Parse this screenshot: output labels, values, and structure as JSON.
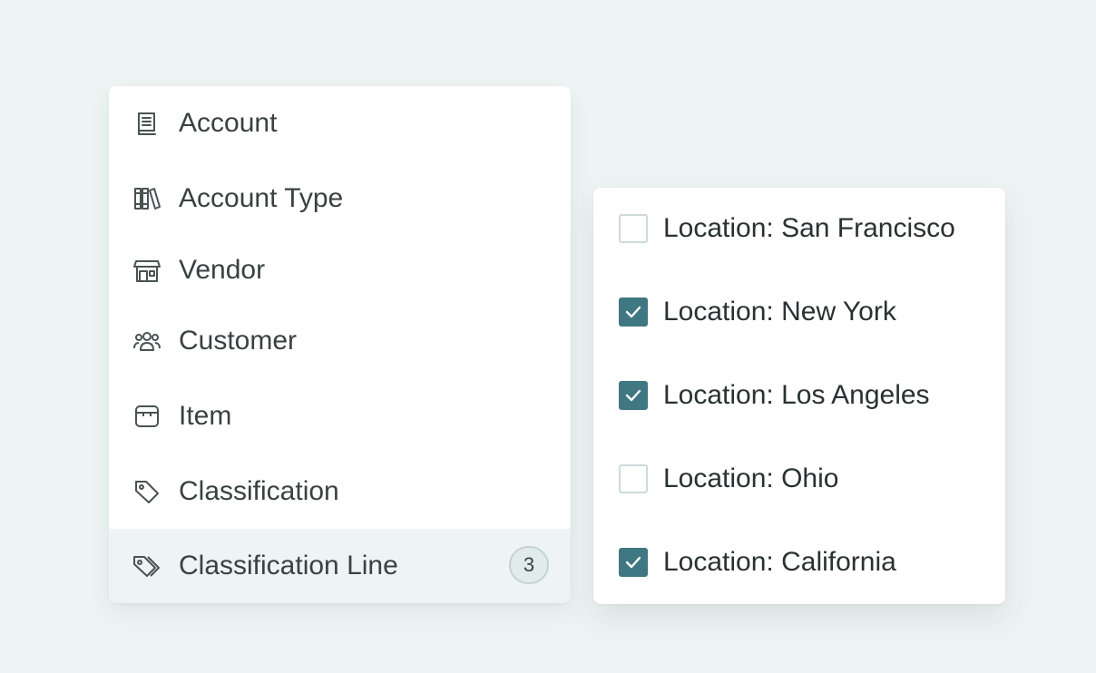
{
  "menu": {
    "items": [
      {
        "label": "Account",
        "icon": "ledger-book-icon"
      },
      {
        "label": "Account Type",
        "icon": "books-icon"
      },
      {
        "label": "Vendor",
        "icon": "storefront-icon"
      },
      {
        "label": "Customer",
        "icon": "users-group-icon"
      },
      {
        "label": "Item",
        "icon": "box-icon"
      },
      {
        "label": "Classification",
        "icon": "tag-icon"
      },
      {
        "label": "Classification Line",
        "icon": "tags-icon",
        "badge": "3",
        "active": true
      }
    ]
  },
  "options": {
    "items": [
      {
        "label": "Location: San Francisco",
        "checked": false
      },
      {
        "label": "Location: New York",
        "checked": true
      },
      {
        "label": "Location: Los Angeles",
        "checked": true
      },
      {
        "label": "Location: Ohio",
        "checked": false
      },
      {
        "label": "Location: California",
        "checked": true
      }
    ]
  },
  "colors": {
    "page_background": "#eef4f4",
    "active_row": "#eef4f4",
    "checkbox_checked": "#3f7782",
    "checkbox_border": "#cddada",
    "icon_stroke": "#4a5252"
  }
}
